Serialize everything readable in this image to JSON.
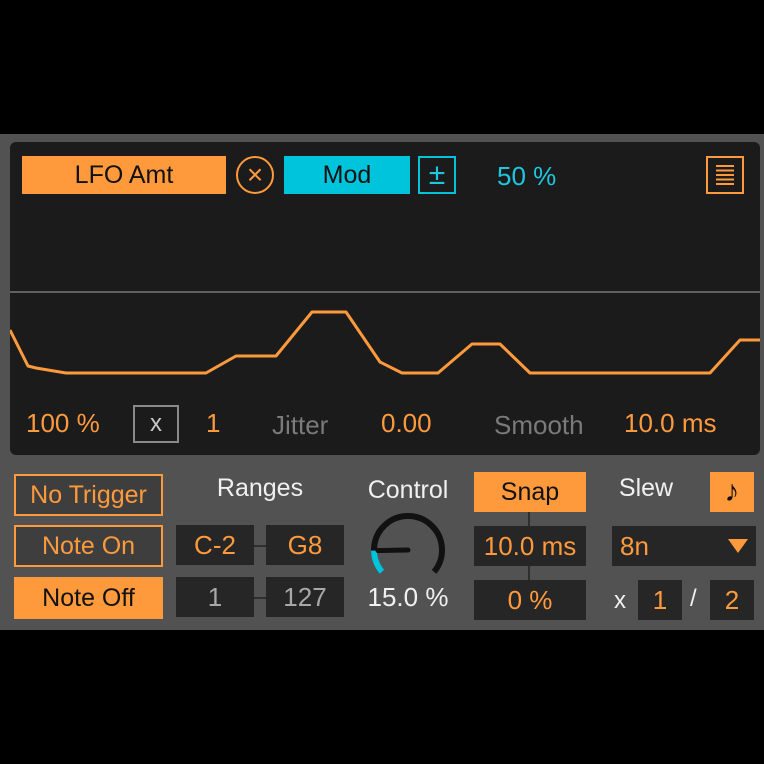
{
  "display": {
    "lfo_amt_label": "LFO Amt",
    "clear_symbol": "×",
    "mod_label": "Mod",
    "plusminus_symbol": "±",
    "mod_percent": "50 %",
    "depth": "100 %",
    "x_toggle": "x",
    "multiplier": "1",
    "jitter_label": "Jitter",
    "jitter_value": "0.00",
    "smooth_label": "Smooth",
    "smooth_value": "10.0 ms"
  },
  "triggers": {
    "no_trigger": "No Trigger",
    "note_on": "Note On",
    "note_off": "Note Off"
  },
  "ranges": {
    "label": "Ranges",
    "note_low": "C-2",
    "note_high": "G8",
    "vel_low": "1",
    "vel_high": "127"
  },
  "control": {
    "label": "Control",
    "value": "15.0 %",
    "level": 0.15
  },
  "snap": {
    "label": "Snap",
    "time": "10.0 ms",
    "percent": "0 %"
  },
  "slew": {
    "label": "Slew",
    "note_symbol": "♪",
    "rate": "8n",
    "x_label": "x",
    "numerator": "1",
    "slash": "/",
    "denominator": "2"
  },
  "colors": {
    "accent_orange": "#ff9a3c",
    "accent_cyan": "#00c3dc",
    "panel_bg": "#525252",
    "display_bg": "#1b1b1b"
  },
  "icons": [
    "close-circle-icon",
    "plus-minus-icon",
    "menu-list-icon",
    "music-note-icon",
    "dropdown-triangle-icon"
  ]
}
